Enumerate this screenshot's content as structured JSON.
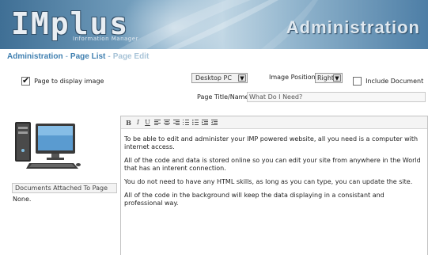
{
  "header": {
    "logo_text": "IMplus",
    "logo_subtitle": "Information Manager",
    "admin_title": "Administration"
  },
  "breadcrumb": {
    "items": [
      "Administration",
      "Page List",
      "Page Edit"
    ],
    "separator": "-"
  },
  "options": {
    "page_to_display_image": {
      "label": "Page to display image",
      "checked": true
    },
    "device_select": {
      "value": "Desktop PC"
    },
    "image_position": {
      "label": "Image Position:",
      "value": "Right"
    },
    "include_document_list": {
      "label": "Include Document List",
      "checked": false
    }
  },
  "page_title": {
    "label": "Page Title/Name:",
    "value": "What Do I Need?"
  },
  "documents": {
    "header": "Documents Attached To Page",
    "value": "None."
  },
  "editor": {
    "toolbar_buttons": [
      "bold",
      "italic",
      "underline",
      "align-left",
      "align-center",
      "align-right",
      "ordered-list",
      "unordered-list",
      "indent",
      "outdent"
    ],
    "toolbar_labels": {
      "bold": "B",
      "italic": "I",
      "underline": "U"
    },
    "paragraphs": [
      "To be able to edit and administer your IMP powered website, all you need is a computer with internet access.",
      "All of the code and data is stored online so you can edit your site from anywhere in the World that has an interent connection.",
      "You do not need to have any HTML skills, as long as you can type, you can update the site.",
      "All of the code in the background will keep the data displaying in a consistant and professional way."
    ]
  },
  "colors": {
    "link": "#3f7fb0",
    "breadcrumb_current": "#a9c4d8",
    "banner_dark": "#3f6f95",
    "banner_light": "#c0d6e4"
  }
}
